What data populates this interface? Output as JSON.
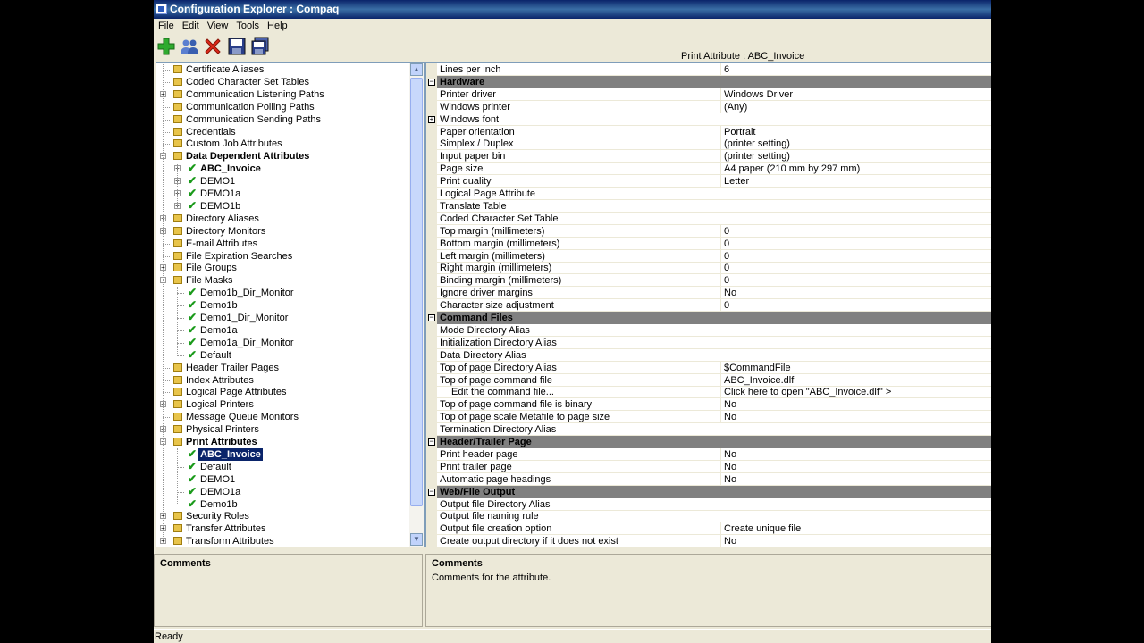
{
  "window": {
    "title": "Configuration Explorer : Compaq"
  },
  "menu": [
    "File",
    "Edit",
    "View",
    "Tools",
    "Help"
  ],
  "toolbar": {
    "icons": [
      "add-icon",
      "users-icon",
      "delete-icon",
      "save-icon",
      "save-all-icon"
    ]
  },
  "property_header": "Print Attribute : ABC_Invoice",
  "tree": [
    {
      "label": "Certificate Aliases",
      "level": 0,
      "icon": "folder",
      "expander": ""
    },
    {
      "label": "Coded Character Set Tables",
      "level": 0,
      "icon": "folder",
      "expander": ""
    },
    {
      "label": "Communication Listening Paths",
      "level": 0,
      "icon": "folder",
      "expander": "+"
    },
    {
      "label": "Communication Polling Paths",
      "level": 0,
      "icon": "folder",
      "expander": ""
    },
    {
      "label": "Communication Sending Paths",
      "level": 0,
      "icon": "folder",
      "expander": ""
    },
    {
      "label": "Credentials",
      "level": 0,
      "icon": "folder",
      "expander": ""
    },
    {
      "label": "Custom Job Attributes",
      "level": 0,
      "icon": "folder",
      "expander": ""
    },
    {
      "label": "Data Dependent Attributes",
      "level": 0,
      "icon": "folder",
      "expander": "-",
      "bold": true
    },
    {
      "label": "ABC_Invoice",
      "level": 1,
      "icon": "check",
      "expander": "+",
      "bold": true
    },
    {
      "label": "DEMO1",
      "level": 1,
      "icon": "check",
      "expander": "+"
    },
    {
      "label": "DEMO1a",
      "level": 1,
      "icon": "check",
      "expander": "+"
    },
    {
      "label": "DEMO1b",
      "level": 1,
      "icon": "check",
      "expander": "+"
    },
    {
      "label": "Directory Aliases",
      "level": 0,
      "icon": "folder",
      "expander": "+"
    },
    {
      "label": "Directory Monitors",
      "level": 0,
      "icon": "folder",
      "expander": "+"
    },
    {
      "label": "E-mail Attributes",
      "level": 0,
      "icon": "folder",
      "expander": ""
    },
    {
      "label": "File Expiration Searches",
      "level": 0,
      "icon": "folder",
      "expander": ""
    },
    {
      "label": "File Groups",
      "level": 0,
      "icon": "folder",
      "expander": "+"
    },
    {
      "label": "File Masks",
      "level": 0,
      "icon": "folder",
      "expander": "-"
    },
    {
      "label": "Demo1b_Dir_Monitor",
      "level": 1,
      "icon": "check",
      "expander": ""
    },
    {
      "label": "Demo1b",
      "level": 1,
      "icon": "check",
      "expander": ""
    },
    {
      "label": "Demo1_Dir_Monitor",
      "level": 1,
      "icon": "check",
      "expander": ""
    },
    {
      "label": "Demo1a",
      "level": 1,
      "icon": "check",
      "expander": ""
    },
    {
      "label": "Demo1a_Dir_Monitor",
      "level": 1,
      "icon": "check",
      "expander": ""
    },
    {
      "label": "Default",
      "level": 1,
      "icon": "check",
      "expander": ""
    },
    {
      "label": "Header Trailer Pages",
      "level": 0,
      "icon": "folder",
      "expander": ""
    },
    {
      "label": "Index Attributes",
      "level": 0,
      "icon": "folder",
      "expander": ""
    },
    {
      "label": "Logical Page Attributes",
      "level": 0,
      "icon": "folder",
      "expander": ""
    },
    {
      "label": "Logical Printers",
      "level": 0,
      "icon": "folder",
      "expander": "+"
    },
    {
      "label": "Message Queue Monitors",
      "level": 0,
      "icon": "folder",
      "expander": ""
    },
    {
      "label": "Physical Printers",
      "level": 0,
      "icon": "folder",
      "expander": "+"
    },
    {
      "label": "Print Attributes",
      "level": 0,
      "icon": "folder",
      "expander": "-",
      "bold": true
    },
    {
      "label": "ABC_Invoice",
      "level": 1,
      "icon": "check",
      "expander": "",
      "bold": true,
      "selected": true
    },
    {
      "label": "Default",
      "level": 1,
      "icon": "check",
      "expander": ""
    },
    {
      "label": "DEMO1",
      "level": 1,
      "icon": "check",
      "expander": ""
    },
    {
      "label": "DEMO1a",
      "level": 1,
      "icon": "check",
      "expander": ""
    },
    {
      "label": "Demo1b",
      "level": 1,
      "icon": "check",
      "expander": ""
    },
    {
      "label": "Security Roles",
      "level": 0,
      "icon": "folder",
      "expander": "+"
    },
    {
      "label": "Transfer Attributes",
      "level": 0,
      "icon": "folder",
      "expander": "+"
    },
    {
      "label": "Transform Attributes",
      "level": 0,
      "icon": "folder",
      "expander": "+"
    }
  ],
  "properties": [
    {
      "type": "row",
      "name": "Lines per inch",
      "value": "6"
    },
    {
      "type": "category",
      "name": "Hardware"
    },
    {
      "type": "row",
      "name": "Printer driver",
      "value": "Windows Driver"
    },
    {
      "type": "row",
      "name": "Windows printer",
      "value": "(Any)"
    },
    {
      "type": "row",
      "name": "Windows font",
      "value": "",
      "box": "+"
    },
    {
      "type": "row",
      "name": "Paper orientation",
      "value": "Portrait"
    },
    {
      "type": "row",
      "name": "Simplex / Duplex",
      "value": "(printer setting)"
    },
    {
      "type": "row",
      "name": "Input paper bin",
      "value": "(printer setting)"
    },
    {
      "type": "row",
      "name": "Page size",
      "value": "A4 paper (210 mm by 297 mm)"
    },
    {
      "type": "row",
      "name": "Print quality",
      "value": "Letter"
    },
    {
      "type": "row",
      "name": "Logical Page Attribute",
      "value": ""
    },
    {
      "type": "row",
      "name": "Translate Table",
      "value": ""
    },
    {
      "type": "row",
      "name": "Coded Character Set Table",
      "value": ""
    },
    {
      "type": "row",
      "name": "Top margin (millimeters)",
      "value": "0"
    },
    {
      "type": "row",
      "name": "Bottom margin (millimeters)",
      "value": "0"
    },
    {
      "type": "row",
      "name": "Left margin (millimeters)",
      "value": "0"
    },
    {
      "type": "row",
      "name": "Right margin (millimeters)",
      "value": "0"
    },
    {
      "type": "row",
      "name": "Binding margin (millimeters)",
      "value": "0"
    },
    {
      "type": "row",
      "name": "Ignore driver margins",
      "value": "No"
    },
    {
      "type": "row",
      "name": "Character size adjustment",
      "value": "0"
    },
    {
      "type": "category",
      "name": "Command Files"
    },
    {
      "type": "row",
      "name": "Mode Directory Alias",
      "value": ""
    },
    {
      "type": "row",
      "name": "Initialization Directory Alias",
      "value": ""
    },
    {
      "type": "row",
      "name": "Data Directory Alias",
      "value": ""
    },
    {
      "type": "row",
      "name": "Top of page Directory Alias",
      "value": "$CommandFile"
    },
    {
      "type": "row",
      "name": "Top of page command file",
      "value": "ABC_Invoice.dlf"
    },
    {
      "type": "row",
      "name": "Edit the command file...",
      "value": "Click here to open \"ABC_Invoice.dlf\" >",
      "indent": true
    },
    {
      "type": "row",
      "name": "Top of page command file is binary",
      "value": "No"
    },
    {
      "type": "row",
      "name": "Top of page scale Metafile to page size",
      "value": "No"
    },
    {
      "type": "row",
      "name": "Termination Directory Alias",
      "value": ""
    },
    {
      "type": "category",
      "name": "Header/Trailer Page"
    },
    {
      "type": "row",
      "name": "Print header page",
      "value": "No"
    },
    {
      "type": "row",
      "name": "Print trailer page",
      "value": "No"
    },
    {
      "type": "row",
      "name": "Automatic page headings",
      "value": "No"
    },
    {
      "type": "category",
      "name": "Web/File Output"
    },
    {
      "type": "row",
      "name": "Output file Directory Alias",
      "value": ""
    },
    {
      "type": "row",
      "name": "Output file naming rule",
      "value": ""
    },
    {
      "type": "row",
      "name": "Output file creation option",
      "value": "Create unique file"
    },
    {
      "type": "row",
      "name": "Create output directory if it does not exist",
      "value": "No"
    }
  ],
  "comments_left": {
    "title": "Comments",
    "text": ""
  },
  "comments_right": {
    "title": "Comments",
    "text": "Comments for the attribute."
  },
  "status": "Ready",
  "colors": {
    "selection": "#0a246a",
    "category": "#808080",
    "check": "#1a9a1a",
    "folder": "#e8c44a"
  }
}
